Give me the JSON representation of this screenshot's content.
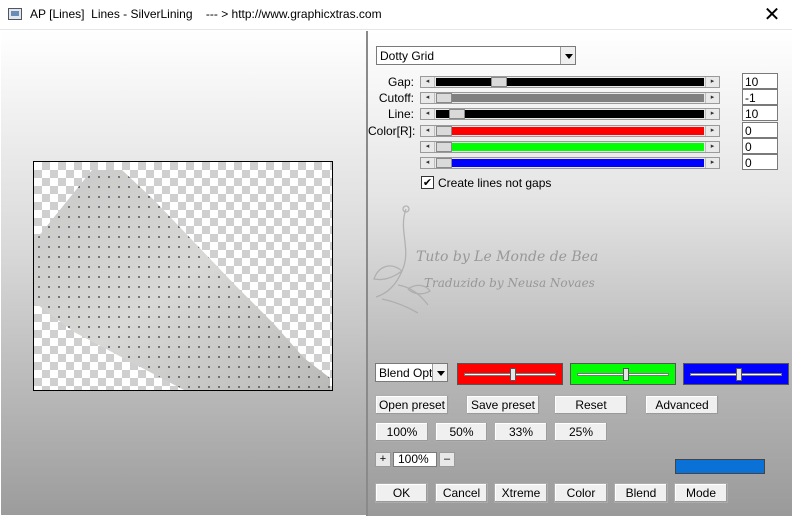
{
  "window": {
    "title": "AP [Lines]  Lines - SilverLining    --- > http://www.graphicxtras.com",
    "close_glyph": "✕"
  },
  "effect": {
    "selected": "Dotty Grid"
  },
  "sliders": [
    {
      "label": "Gap:",
      "value": "10",
      "track_color": "#000000",
      "level": 0.22
    },
    {
      "label": "Cutoff:",
      "value": "-1",
      "track_color": "#808080",
      "level": 0.0
    },
    {
      "label": "Line:",
      "value": "10",
      "track_color": "#000000",
      "level": 0.05
    },
    {
      "label": "Color[R]:",
      "value": "0",
      "track_color": "#ff0000",
      "level": 0.0
    },
    {
      "label": "",
      "value": "0",
      "track_color": "#00ff00",
      "level": 0.0
    },
    {
      "label": "",
      "value": "0",
      "track_color": "#0000ff",
      "level": 0.0
    }
  ],
  "arrows": {
    "left": "◂",
    "right": "▸"
  },
  "checkbox": {
    "label": "Create lines not gaps",
    "checked": true,
    "mark": "✔"
  },
  "watermark": {
    "line1": "Tuto by Le Monde de Bea",
    "line2": "Traduzido by Neusa Novaes"
  },
  "blend": {
    "selected": "Blend Optio",
    "boxes": [
      {
        "color": "#ff0000",
        "level": 0.53
      },
      {
        "color": "#00ff00",
        "level": 0.53
      },
      {
        "color": "#0000ff",
        "level": 0.53
      }
    ]
  },
  "buttons": {
    "open_preset": "Open preset",
    "save_preset": "Save preset",
    "reset": "Reset",
    "advanced": "Advanced",
    "zoom_100": "100%",
    "zoom_50": "50%",
    "zoom_33": "33%",
    "zoom_25": "25%",
    "ok": "OK",
    "cancel": "Cancel",
    "xtreme": "Xtreme",
    "color": "Color",
    "blend": "Blend",
    "mode": "Mode"
  },
  "zoom": {
    "value": "100%",
    "plus": "+",
    "minus": "–"
  },
  "swatch": {
    "color": "#0a72d6"
  }
}
